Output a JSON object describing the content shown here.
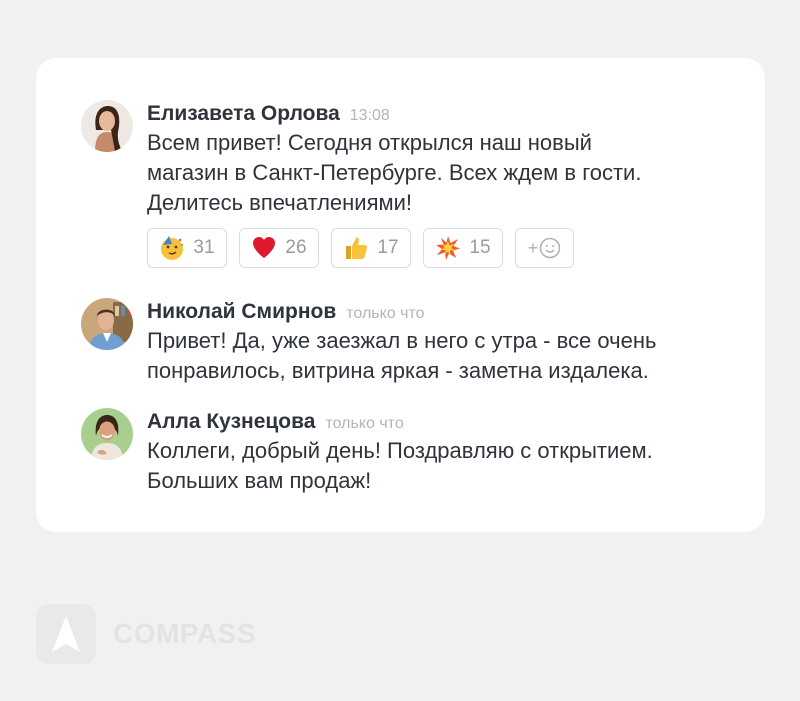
{
  "messages": [
    {
      "author": "Елизавета Орлова",
      "time": "13:08",
      "lines": [
        "Всем привет! Сегодня открылся наш новый",
        "магазин в Санкт-Петербурге. Всех ждем в гости.",
        "Делитесь впечатлениями!"
      ],
      "reactions": [
        {
          "icon": "party-face-emoji",
          "count": "31"
        },
        {
          "icon": "red-heart-emoji",
          "count": "26"
        },
        {
          "icon": "thumbs-up-emoji",
          "count": "17"
        },
        {
          "icon": "collision-emoji",
          "count": "15"
        }
      ],
      "add_reaction": {
        "label": "+",
        "icon": "smiley-icon"
      }
    },
    {
      "author": "Николай Смирнов",
      "time": "только что",
      "lines": [
        "Привет! Да, уже заезжал в него с утра - все очень",
        "понравилось, витрина яркая - заметна издалека."
      ]
    },
    {
      "author": "Алла Кузнецова",
      "time": "только что",
      "lines": [
        "Коллеги, добрый день! Поздравляю с открытием.",
        "Больших вам продаж!"
      ]
    }
  ],
  "brand": {
    "name": "COMPASS",
    "icon": "compass-arrow-icon"
  },
  "colors": {
    "background": "#f1f1f1",
    "card": "#ffffff",
    "text": "#2f333b",
    "muted": "#b4b4b4",
    "heart": "#e0192e"
  }
}
